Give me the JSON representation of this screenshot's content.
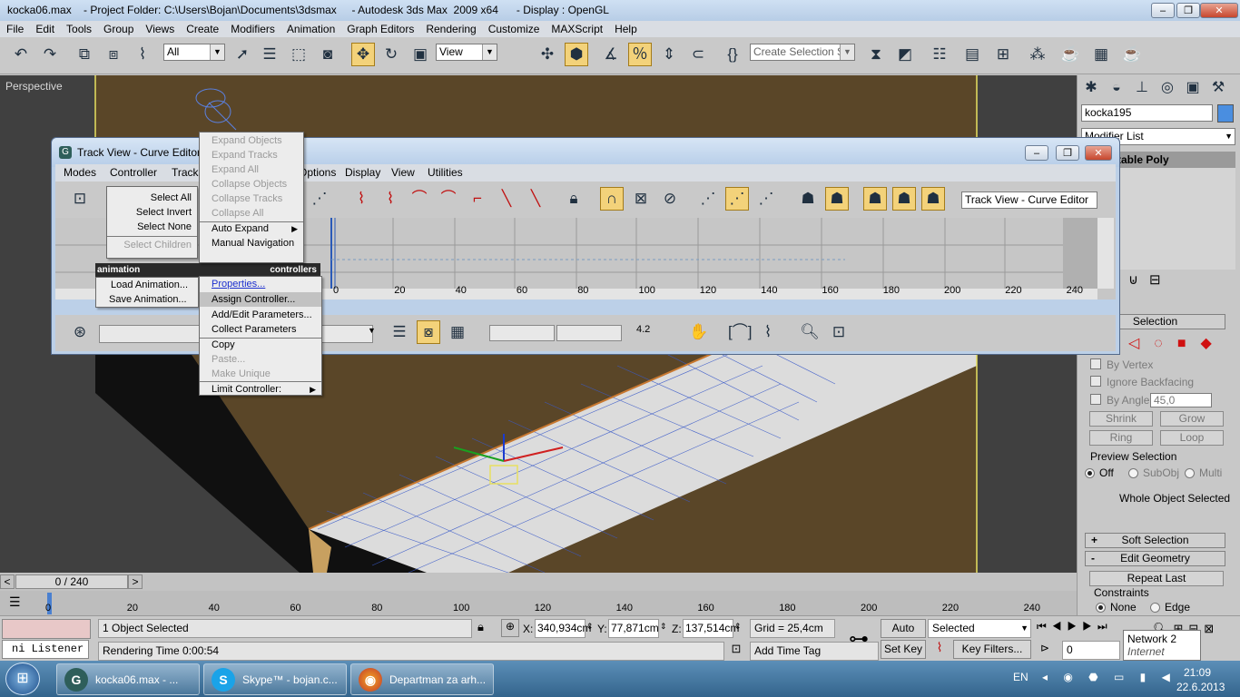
{
  "window": {
    "title": "kocka06.max    - Project Folder: C:\\Users\\Bojan\\Documents\\3dsmax     - Autodesk 3ds Max  2009 x64      - Display : OpenGL",
    "buttons": {
      "minimize": "–",
      "restore": "❐",
      "close": "✕"
    }
  },
  "menubar": [
    "File",
    "Edit",
    "Tools",
    "Group",
    "Views",
    "Create",
    "Modifiers",
    "Animation",
    "Graph Editors",
    "Rendering",
    "Customize",
    "MAXScript",
    "Help"
  ],
  "toolbar": {
    "selection_filter": "All",
    "ref_coord": "View",
    "named_selection_placeholder": "Create Selection Set",
    "icons": [
      "undo-icon",
      "redo-icon",
      "select-link-icon",
      "unlink-icon",
      "bind-spacewarp-icon",
      "select-object-icon",
      "select-by-name-icon",
      "rect-region-icon",
      "window-crossing-icon",
      "move-icon",
      "rotate-icon",
      "scale-icon",
      "pivot-icon",
      "snap-3d-icon",
      "angle-snap-icon",
      "percent-snap-icon",
      "spinner-snap-icon",
      "edit-named-sel-icon",
      "mirror-icon",
      "align-icon",
      "layer-manager-icon",
      "curve-editor-icon",
      "schematic-icon",
      "material-editor-icon",
      "render-setup-icon",
      "rendered-frame-icon",
      "render-icon"
    ]
  },
  "viewport": {
    "label": "Perspective"
  },
  "command_panel": {
    "object_name": "kocka195",
    "object_color": "#4a8ee0",
    "modifier_list": "Modifier List",
    "stack_item": "table Poly",
    "selection_header": "Selection",
    "by_vertex": "By Vertex",
    "ignore_backfacing": "Ignore Backfacing",
    "by_angle": "By Angle:",
    "by_angle_value": "45,0",
    "shrink": "Shrink",
    "grow": "Grow",
    "ring": "Ring",
    "loop": "Loop",
    "preview_selection": "Preview Selection",
    "preview_off": "Off",
    "preview_subobj": "SubObj",
    "preview_multi": "Multi",
    "whole_object": "Whole Object Selected",
    "soft_selection": "Soft Selection",
    "edit_geometry": "Edit Geometry",
    "repeat_last": "Repeat Last",
    "constraints": "Constraints",
    "constraint_none": "None",
    "constraint_edge": "Edge",
    "plus": "+",
    "minus": "-"
  },
  "trackview": {
    "title": "Track View - Curve Editor",
    "menu": [
      "Modes",
      "Controller",
      "Tracks",
      "Options",
      "Display",
      "View",
      "Utilities"
    ],
    "name_field": "Track View - Curve Editor",
    "ruler": [
      "0",
      "20",
      "40",
      "60",
      "80",
      "100",
      "120",
      "140",
      "160",
      "180",
      "200",
      "220",
      "240"
    ],
    "zoom_value": "4.2"
  },
  "context_menu_left": {
    "items": [
      "Select All",
      "Select Invert",
      "Select None",
      "Select Children"
    ],
    "header_left": "animation",
    "header_right": "controllers",
    "bottom_items": [
      "Load Animation...",
      "Save Animation..."
    ]
  },
  "context_menu_right": {
    "top": [
      "Expand Objects",
      "Expand Tracks",
      "Expand All",
      "Collapse Objects",
      "Collapse Tracks",
      "Collapse All"
    ],
    "mid": [
      "Auto Expand",
      "Manual Navigation"
    ],
    "ctrl": [
      "Properties...",
      "Assign Controller...",
      "Add/Edit Parameters...",
      "Collect Parameters"
    ],
    "edit": [
      "Copy",
      "Paste...",
      "Make Unique"
    ],
    "limit": "Limit Controller:"
  },
  "timeslider": {
    "frame": "0 / 240",
    "ticks": [
      "0",
      "20",
      "40",
      "60",
      "80",
      "100",
      "120",
      "140",
      "160",
      "180",
      "200",
      "220",
      "240"
    ]
  },
  "status": {
    "listener": "ni Listener",
    "selected": "1 Object Selected",
    "rendering_time": "Rendering Time  0:00:54",
    "x_label": "X:",
    "x": "340,934cm",
    "y_label": "Y:",
    "y": "77,871cm",
    "z_label": "Z:",
    "z": "137,514cm",
    "grid": "Grid = 25,4cm",
    "add_time_tag": "Add Time Tag",
    "auto_key": "Auto Key",
    "set_key": "Set Key",
    "key_mode": "Selected",
    "key_filters": "Key Filters...",
    "frame_field": "0"
  },
  "tooltip": {
    "line1": "Network  2",
    "line2": "Internet access"
  },
  "taskbar": {
    "tasks": [
      {
        "label": "kocka06.max    - ..."
      },
      {
        "label": "Skype™ - bojan.c..."
      },
      {
        "label": "Departman za arh..."
      }
    ],
    "lang": "EN",
    "time": "21:09",
    "date": "22.6.2013"
  }
}
